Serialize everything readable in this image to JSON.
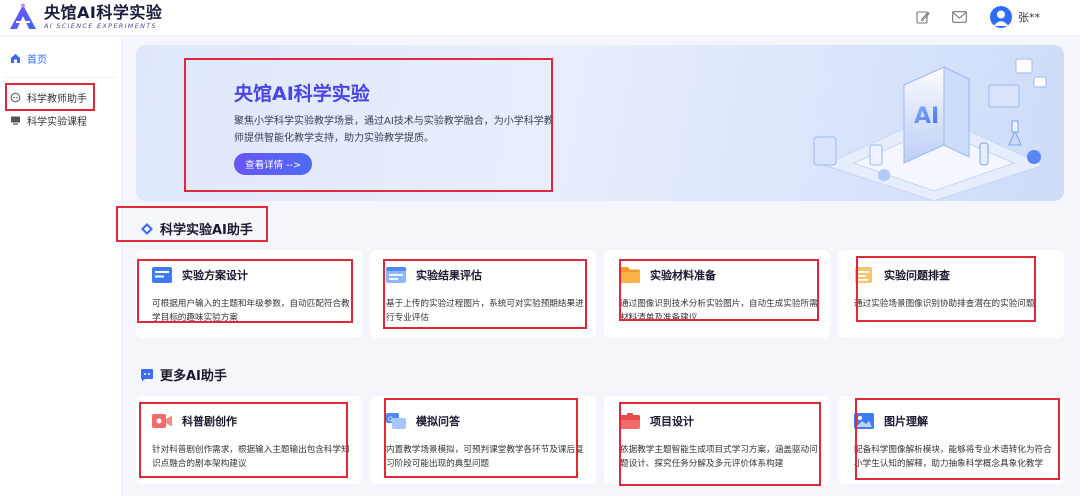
{
  "header": {
    "logo_title": "央馆AI科学实验",
    "logo_subtitle": "AI SCIENCE EXPERIMENTS",
    "user_name": "张**",
    "icons": [
      "edit-icon",
      "mail-icon",
      "user-avatar-icon"
    ]
  },
  "sidebar": {
    "items": [
      {
        "label": "首页",
        "icon": "home-icon",
        "active": true
      },
      {
        "label": "科学教师助手",
        "icon": "assistant-icon",
        "active": false
      },
      {
        "label": "科学实验课程",
        "icon": "course-icon",
        "active": false
      }
    ]
  },
  "banner": {
    "title": "央馆AI科学实验",
    "description": "聚焦小学科学实验教学场景，通过AI技术与实验教学融合，为小学科学教师提供智能化教学支持，助力实验教学提质。",
    "button_label": "查看详情 -->"
  },
  "sections": [
    {
      "title": "科学实验AI助手",
      "icon": "diamond-icon",
      "cards": [
        {
          "title": "实验方案设计",
          "icon": "plan-doc-icon",
          "desc": "可根据用户输入的主题和年级参数，自动匹配符合教学目标的趣味实验方案"
        },
        {
          "title": "实验结果评估",
          "icon": "evaluation-icon",
          "desc": "基于上传的实验过程图片，系统可对实验预期结果进行专业评估"
        },
        {
          "title": "实验材料准备",
          "icon": "folder-icon",
          "desc": "通过图像识别技术分析实验图片，自动生成实验所需材料清单及准备建议"
        },
        {
          "title": "实验问题排查",
          "icon": "checklist-icon",
          "desc": "通过实验场景图像识别协助排查潜在的实验问题"
        }
      ]
    },
    {
      "title": "更多AI助手",
      "icon": "chat-bubble-icon",
      "cards": [
        {
          "title": "科普剧创作",
          "icon": "video-icon",
          "desc": "针对科普剧创作需求，根据输入主题输出包含科学知识点融合的剧本架构建议"
        },
        {
          "title": "模拟问答",
          "icon": "qa-icon",
          "desc": "内置教学场景模拟，可预判课堂教学各环节及课后复习阶段可能出现的典型问题"
        },
        {
          "title": "项目设计",
          "icon": "project-icon",
          "desc": "依据教学主题智能生成项目式学习方案，涵盖驱动问题设计、探究任务分解及多元评价体系构建"
        },
        {
          "title": "图片理解",
          "icon": "image-icon",
          "desc": "配备科学图像解析模块，能够将专业术语转化为符合小学生认知的解释，助力抽象科学概念具象化教学"
        }
      ]
    }
  ],
  "colors": {
    "accent": "#2f6bff",
    "banner_title": "#4a45e0",
    "annotation": "#e0283a",
    "page_bg": "#f4f6fb"
  }
}
